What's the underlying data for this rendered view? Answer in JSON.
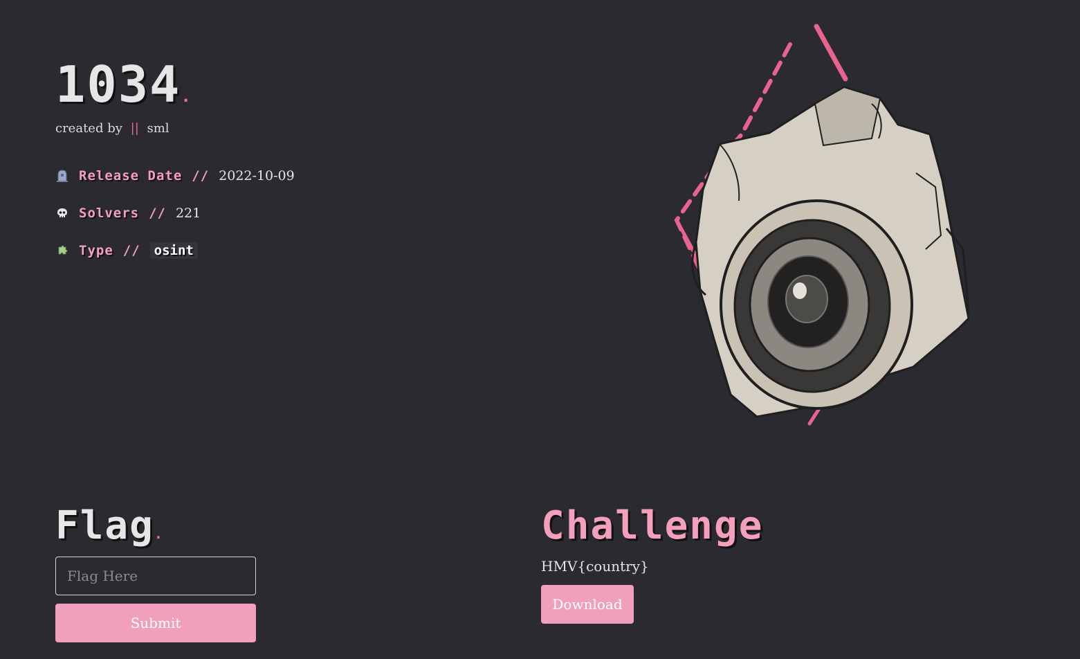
{
  "challenge": {
    "title": "1034",
    "title_dot": ".",
    "created_by_prefix": "created by",
    "separator": "||",
    "author": "sml"
  },
  "meta": {
    "release": {
      "icon": "tombstone-icon",
      "label": "Release Date",
      "slash": "//",
      "value": "2022-10-09"
    },
    "solvers": {
      "icon": "skull-icon",
      "label": "Solvers",
      "slash": "//",
      "value": "221"
    },
    "type": {
      "icon": "puzzle-icon",
      "label": "Type",
      "slash": "//",
      "value": "osint"
    }
  },
  "flag": {
    "heading": "Flag",
    "heading_dot": ".",
    "placeholder": "Flag Here",
    "submit_label": "Submit"
  },
  "challenge_section": {
    "heading": "Challenge",
    "flag_format": "HMV{country}",
    "download_label": "Download"
  },
  "image": {
    "subject": "camera-sketch-illustration"
  },
  "colors": {
    "background": "#2b2a30",
    "accent": "#f4a0bd",
    "button": "#f0a0bd",
    "accent_dark": "#f0679e"
  }
}
